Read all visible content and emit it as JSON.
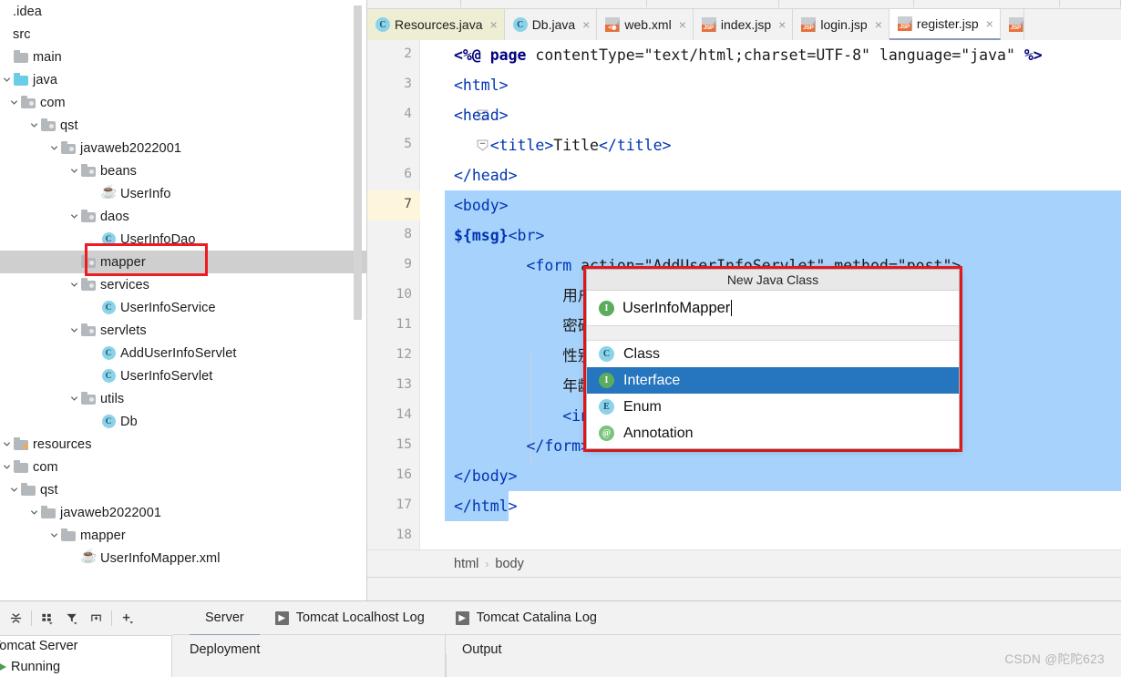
{
  "project_tree": {
    "items": [
      {
        "label": ".idea",
        "depth": 0,
        "icon": "none",
        "twisty": "none"
      },
      {
        "label": "src",
        "depth": 0,
        "icon": "none",
        "twisty": "none"
      },
      {
        "label": "main",
        "depth": 0,
        "icon": "folder-gray",
        "twisty": "none"
      },
      {
        "label": "java",
        "depth": 1,
        "icon": "folder-cyan",
        "twisty": "expanded"
      },
      {
        "label": "com",
        "depth": 2,
        "icon": "folder-src",
        "twisty": "expanded"
      },
      {
        "label": "qst",
        "depth": 3,
        "icon": "folder-src",
        "twisty": "expanded"
      },
      {
        "label": "javaweb2022001",
        "depth": 4,
        "icon": "folder-src",
        "twisty": "expanded"
      },
      {
        "label": "beans",
        "depth": 5,
        "icon": "folder-src",
        "twisty": "expanded"
      },
      {
        "label": "UserInfo",
        "depth": 6,
        "icon": "java-bean",
        "twisty": "none"
      },
      {
        "label": "daos",
        "depth": 5,
        "icon": "folder-src",
        "twisty": "expanded"
      },
      {
        "label": "UserInfoDao",
        "depth": 6,
        "icon": "class",
        "twisty": "none"
      },
      {
        "label": "mapper",
        "depth": 5,
        "icon": "folder-src",
        "twisty": "none",
        "selected": true
      },
      {
        "label": "services",
        "depth": 5,
        "icon": "folder-src",
        "twisty": "expanded"
      },
      {
        "label": "UserInfoService",
        "depth": 6,
        "icon": "class",
        "twisty": "none"
      },
      {
        "label": "servlets",
        "depth": 5,
        "icon": "folder-src",
        "twisty": "expanded"
      },
      {
        "label": "AddUserInfoServlet",
        "depth": 6,
        "icon": "class",
        "twisty": "none"
      },
      {
        "label": "UserInfoServlet",
        "depth": 6,
        "icon": "class",
        "twisty": "none"
      },
      {
        "label": "utils",
        "depth": 5,
        "icon": "folder-src",
        "twisty": "expanded"
      },
      {
        "label": "Db",
        "depth": 6,
        "icon": "class",
        "twisty": "none"
      },
      {
        "label": "resources",
        "depth": 0,
        "icon": "folder-res",
        "twisty": "expanded"
      },
      {
        "label": "com",
        "depth": 1,
        "icon": "folder-gray",
        "twisty": "expanded"
      },
      {
        "label": "qst",
        "depth": 2,
        "icon": "folder-gray",
        "twisty": "expanded"
      },
      {
        "label": "javaweb2022001",
        "depth": 3,
        "icon": "folder-gray",
        "twisty": "expanded"
      },
      {
        "label": "mapper",
        "depth": 4,
        "icon": "folder-gray",
        "twisty": "expanded"
      },
      {
        "label": "UserInfoMapper.xml",
        "depth": 5,
        "icon": "xml-bean",
        "twisty": "none"
      }
    ]
  },
  "editor": {
    "tabs": [
      {
        "label": "Resources.java",
        "icon": "java-class-icon",
        "style": "first",
        "closable": true
      },
      {
        "label": "Db.java",
        "icon": "java-class-icon",
        "style": "normal",
        "closable": true
      },
      {
        "label": "web.xml",
        "icon": "xml-file-icon",
        "style": "normal",
        "closable": true
      },
      {
        "label": "index.jsp",
        "icon": "jsp-file-icon",
        "style": "normal",
        "closable": true
      },
      {
        "label": "login.jsp",
        "icon": "jsp-file-icon",
        "style": "normal",
        "closable": true
      },
      {
        "label": "register.jsp",
        "icon": "jsp-file-icon",
        "style": "active",
        "closable": true
      }
    ],
    "breadcrumb": {
      "first": "html",
      "separator": "›",
      "second": "body"
    },
    "lines": [
      {
        "n": "2",
        "text": "<%@ page contentType=\"text/html;charset=UTF-8\" language=\"java\" %>"
      },
      {
        "n": "3",
        "text": "<html>"
      },
      {
        "n": "4",
        "text": "<head>"
      },
      {
        "n": "5",
        "text": "    <title>Title</title>"
      },
      {
        "n": "6",
        "text": "</head>"
      },
      {
        "n": "7",
        "text": "<body>"
      },
      {
        "n": "8",
        "text": "${msg}<br>"
      },
      {
        "n": "9",
        "text": "        <form action=\"AddUserInfoServlet\" method=\"post\">"
      },
      {
        "n": "10",
        "text": "            用户名：<input type=\"text\" name=\"uname\"><br>"
      },
      {
        "n": "11",
        "text": "            密码：<input type=\"text\" name=\"upwd\"><br>"
      },
      {
        "n": "12",
        "text": "            性别：<input type=\"text\" name=\"usex\"><br>"
      },
      {
        "n": "13",
        "text": "            年龄：<input type=\"text\" name=\"uage\"><br>"
      },
      {
        "n": "14",
        "text": "            <input type=\"submit\" value=\"注册\">"
      },
      {
        "n": "15",
        "text": "        </form>"
      },
      {
        "n": "16",
        "text": "</body>"
      },
      {
        "n": "17",
        "text": "</html>"
      },
      {
        "n": "18",
        "text": ""
      }
    ],
    "caret_line": "7"
  },
  "dialog": {
    "title": "New Java Class",
    "input_value": "UserInfoMapper",
    "input_icon": "interface-icon",
    "options": [
      {
        "label": "Class",
        "badge": "C",
        "badge_kind": "c",
        "selected": false
      },
      {
        "label": "Interface",
        "badge": "I",
        "badge_kind": "i",
        "selected": true
      },
      {
        "label": "Enum",
        "badge": "E",
        "badge_kind": "e",
        "selected": false
      },
      {
        "label": "Annotation",
        "badge": "@",
        "badge_kind": "a",
        "selected": false
      }
    ],
    "selection_color": "#2675bf",
    "annotation_color": "#ee1b22"
  },
  "bottom_panel": {
    "toolbar_icons": [
      "collapse-all-icon",
      "group-by-icon",
      "filter-icon",
      "expand-selection-icon",
      "add-icon"
    ],
    "server": {
      "name": "Tomcat Server",
      "status": "Running"
    },
    "tabs": [
      {
        "label": "Server",
        "icon": "none",
        "active": true
      },
      {
        "label": "Tomcat Localhost Log",
        "icon": "log-icon",
        "active": false
      },
      {
        "label": "Tomcat Catalina Log",
        "icon": "log-icon",
        "active": false
      }
    ],
    "columns": [
      {
        "label": "Deployment"
      },
      {
        "label": "Output"
      }
    ]
  },
  "watermark": "CSDN @陀陀623"
}
